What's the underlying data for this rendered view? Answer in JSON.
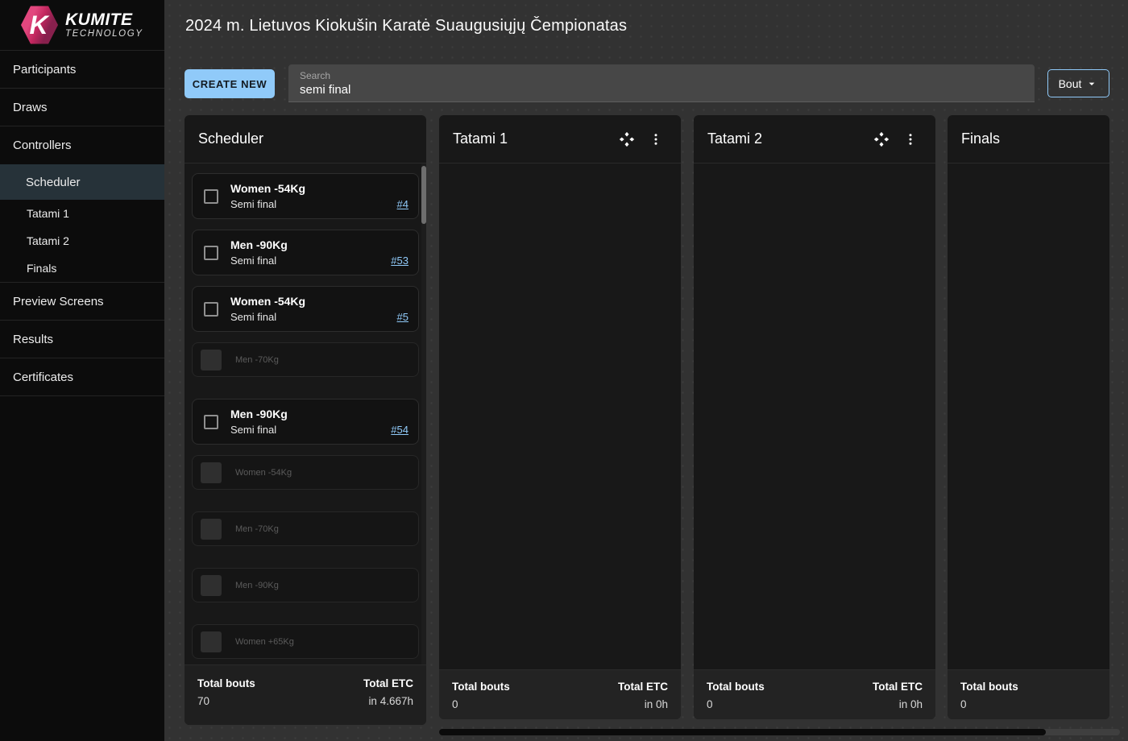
{
  "brand": {
    "logo_letter": "K",
    "name": "KUMITE",
    "tagline": "TECHNOLOGY"
  },
  "header": {
    "title": "2024 m. Lietuvos Kiokušin Karatė Suaugusiųjų Čempionatas"
  },
  "sidebar": {
    "items": [
      {
        "label": "Participants"
      },
      {
        "label": "Draws"
      },
      {
        "label": "Controllers"
      },
      {
        "label": "Scheduler",
        "selected": true
      },
      {
        "label": "Tatami 1"
      },
      {
        "label": "Tatami 2"
      },
      {
        "label": "Finals"
      },
      {
        "label": "Preview Screens"
      },
      {
        "label": "Results"
      },
      {
        "label": "Certificates"
      }
    ]
  },
  "toolbar": {
    "create_button_label": "CREATE NEW",
    "search_label": "Search",
    "search_value": "semi final",
    "bout_button_label": "Bout"
  },
  "scheduler_column": {
    "title": "Scheduler",
    "cards": [
      {
        "title": "Women -54Kg",
        "subtitle": "Semi final",
        "bout_link": "#4",
        "dimmed": false
      },
      {
        "title": "Men -90Kg",
        "subtitle": "Semi final",
        "bout_link": "#53",
        "dimmed": false
      },
      {
        "title": "Women -54Kg",
        "subtitle": "Semi final",
        "bout_link": "#5",
        "dimmed": false
      },
      {
        "title": "Men -70Kg",
        "dimmed": true
      },
      {
        "title": "Men -90Kg",
        "subtitle": "Semi final",
        "bout_link": "#54",
        "dimmed": false
      },
      {
        "title": "Women -54Kg",
        "dimmed": true
      },
      {
        "title": "Men -70Kg",
        "dimmed": true
      },
      {
        "title": "Men -90Kg",
        "dimmed": true
      },
      {
        "title": "Women +65Kg",
        "dimmed": true
      }
    ],
    "footer": {
      "total_bouts_label": "Total bouts",
      "total_bouts_value": "70",
      "total_etc_label": "Total ETC",
      "total_etc_value": "in 4.667h"
    }
  },
  "tatami1": {
    "title": "Tatami 1",
    "footer": {
      "total_bouts_label": "Total bouts",
      "total_bouts_value": "0",
      "total_etc_label": "Total ETC",
      "total_etc_value": "in 0h"
    }
  },
  "tatami2": {
    "title": "Tatami 2",
    "footer": {
      "total_bouts_label": "Total bouts",
      "total_bouts_value": "0",
      "total_etc_label": "Total ETC",
      "total_etc_value": "in 0h"
    }
  },
  "finals": {
    "title": "Finals",
    "footer": {
      "total_bouts_label": "Total bouts",
      "total_bouts_value": "0"
    }
  },
  "colors": {
    "accent_blue": "#90caf9",
    "brand_pink": "#d6336c"
  }
}
